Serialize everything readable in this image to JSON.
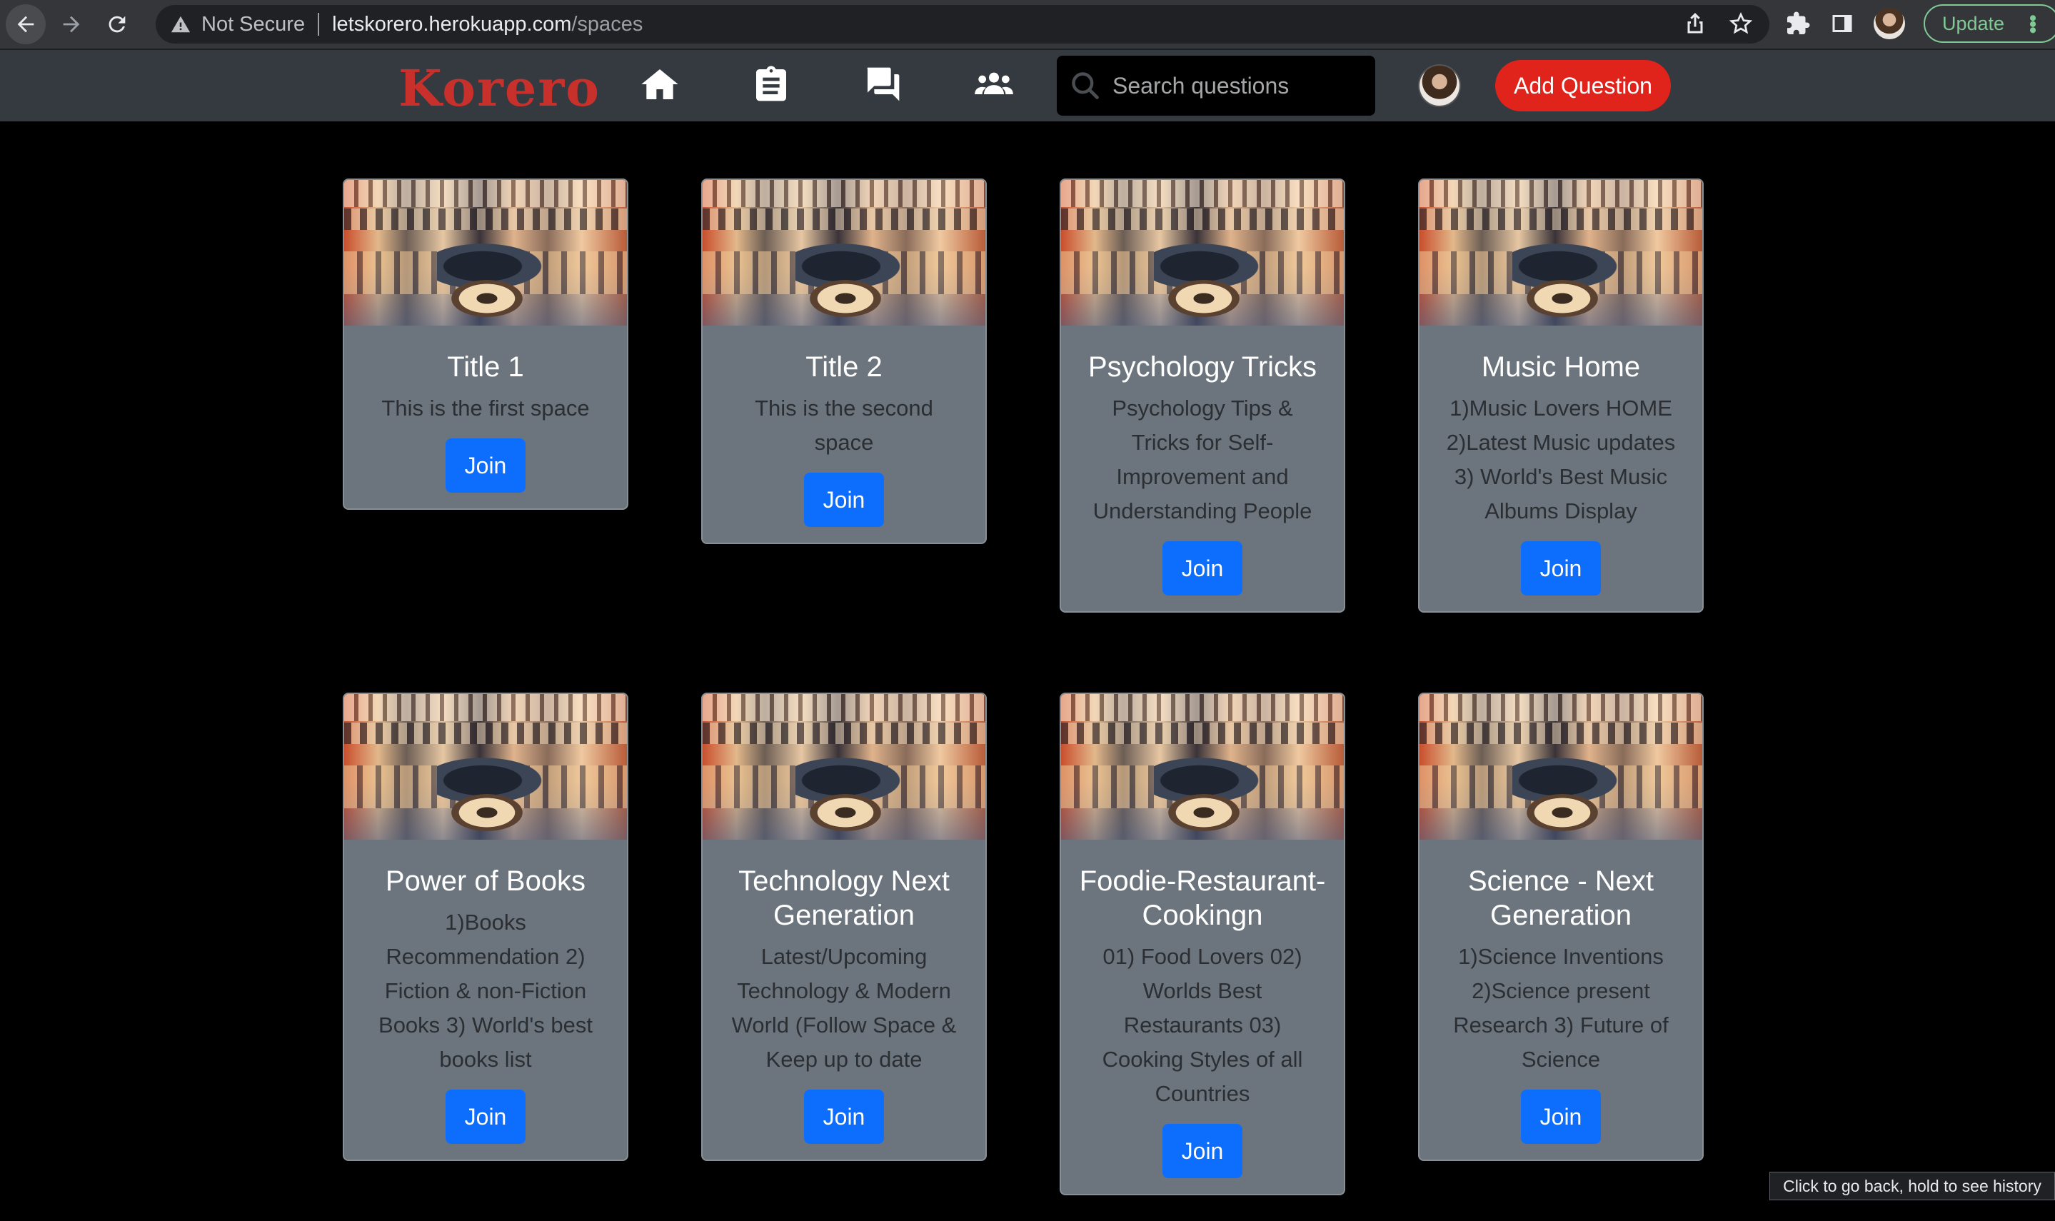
{
  "browser": {
    "security_text": "Not Secure",
    "url_host": "letskorero.herokuapp.com",
    "url_path": "/spaces",
    "update_label": "Update"
  },
  "navbar": {
    "logo": "Korero",
    "icons": [
      "home-icon",
      "clipboard-icon",
      "chat-icon",
      "people-icon"
    ],
    "search_placeholder": "Search questions",
    "add_question_label": "Add Question"
  },
  "spaces": [
    {
      "title": "Title 1",
      "description": "This is the first space",
      "join_label": "Join"
    },
    {
      "title": "Title 2",
      "description": "This is the second space",
      "join_label": "Join"
    },
    {
      "title": "Psychology Tricks",
      "description": "Psychology Tips & Tricks for Self-Improvement and Understanding People",
      "join_label": "Join"
    },
    {
      "title": "Music Home",
      "description": "1)Music Lovers HOME 2)Latest Music updates 3) World's Best Music Albums Display",
      "join_label": "Join"
    },
    {
      "title": "Power of Books",
      "description": "1)Books Recommendation 2) Fiction & non-Fiction Books 3) World's best books list",
      "join_label": "Join"
    },
    {
      "title": "Technology Next Generation",
      "description": "Latest/Upcoming Technology & Modern World (Follow Space & Keep up to date",
      "join_label": "Join"
    },
    {
      "title": "Foodie-Restaurant-Cookingn",
      "description": "01) Food Lovers 02) Worlds Best Restaurants 03) Cooking Styles of all Countries",
      "join_label": "Join"
    },
    {
      "title": "Science - Next Generation",
      "description": "1)Science Inventions 2)Science present Research 3) Future of Science",
      "join_label": "Join"
    }
  ],
  "tooltip": "Click to go back, hold to see history"
}
